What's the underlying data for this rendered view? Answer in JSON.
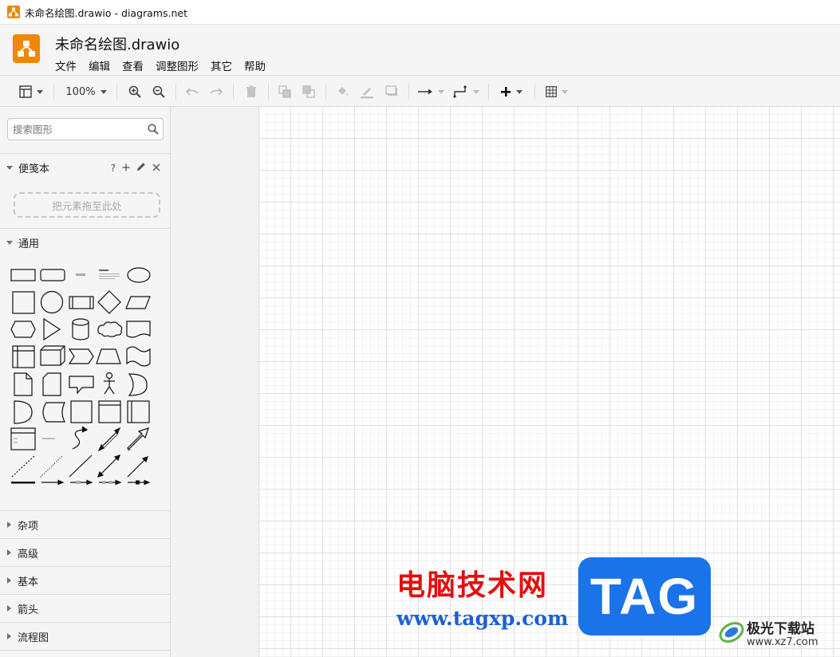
{
  "window": {
    "title": "未命名绘图.drawio - diagrams.net"
  },
  "app": {
    "document_title": "未命名绘图.drawio",
    "logo_color": "#f08705"
  },
  "menu": [
    "文件",
    "编辑",
    "查看",
    "调整图形",
    "其它",
    "帮助"
  ],
  "toolbar": {
    "zoom": "100%",
    "icons": [
      "format-panel-icon",
      "zoom-in-icon",
      "zoom-out-icon",
      "undo-icon",
      "redo-icon",
      "delete-icon",
      "to-front-icon",
      "to-back-icon",
      "fill-color-icon",
      "line-color-icon",
      "shadow-icon",
      "connection-icon",
      "waypoints-icon",
      "insert-icon",
      "table-icon"
    ]
  },
  "sidebar": {
    "search_placeholder": "搜索图形",
    "scratchpad": {
      "title": "便笺本",
      "help": "?",
      "dropzone": "把元素拖至此处"
    },
    "general": {
      "title": "通用"
    },
    "collapsed_sections": [
      "杂项",
      "高级",
      "基本",
      "箭头",
      "流程图"
    ]
  },
  "watermark": {
    "cn_text": "电脑技术网",
    "url": "www.tagxp.com",
    "tag": "TAG",
    "site_cn": "极光下载站",
    "site_en": "www.xz7.com"
  }
}
